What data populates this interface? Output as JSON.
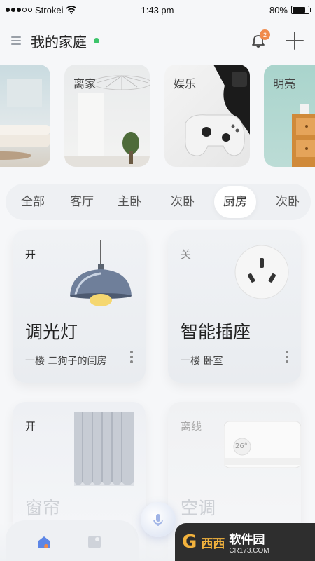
{
  "status_bar": {
    "carrier": "Strokei",
    "time": "1:43 pm",
    "battery_percent": "80%",
    "battery_level": 0.8,
    "signal_bars_filled": 3,
    "signal_bars_total": 5
  },
  "header": {
    "title": "我的家庭",
    "notification_count": "2",
    "menu_icon": "menu-icon",
    "notification_icon": "bell-icon",
    "add_icon": "plus-icon",
    "online_color": "#3cc46a",
    "badge_color": "#f08a4b"
  },
  "scenes": [
    {
      "label": ""
    },
    {
      "label": "离家"
    },
    {
      "label": "娱乐"
    },
    {
      "label": "明亮"
    }
  ],
  "rooms": {
    "tabs": [
      "全部",
      "客厅",
      "主卧",
      "次卧",
      "厨房",
      "次卧"
    ],
    "active": "厨房"
  },
  "devices": [
    {
      "state": "开",
      "name": "调光灯",
      "location": "一楼 二狗子的闺房",
      "icon": "lamp-icon"
    },
    {
      "state": "关",
      "name": "智能插座",
      "location": "一楼 卧室",
      "icon": "socket-icon"
    },
    {
      "state": "开",
      "name": "窗帘",
      "location": "",
      "icon": "curtain-icon"
    },
    {
      "state": "离线",
      "name": "空调",
      "location": "",
      "icon": "air-conditioner-icon",
      "temperature": "26°"
    }
  ],
  "bottom_nav": {
    "items": [
      {
        "icon": "home-icon",
        "active": true
      },
      {
        "icon": "devices-icon",
        "active": false
      }
    ],
    "voice_icon": "microphone-icon"
  },
  "watermark": {
    "logo": "G",
    "logo_text": "西西",
    "name": "软件园",
    "url": "CR173.COM"
  }
}
